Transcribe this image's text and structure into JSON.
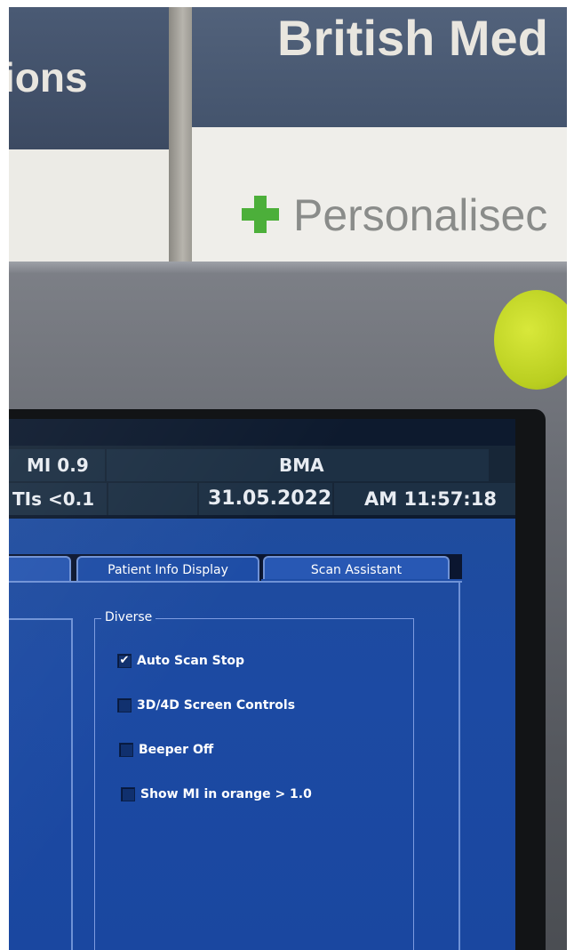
{
  "background_signs": {
    "left_text": "ions",
    "right_text": "British Med",
    "tagline": "Personalisec"
  },
  "statusbar": {
    "mi": "MI 0.9",
    "site": "BMA",
    "tis": "TIs <0.1",
    "date": "31.05.2022",
    "time": "AM 11:57:18"
  },
  "tabs": [
    {
      "label": ""
    },
    {
      "label": "Patient Info Display"
    },
    {
      "label": "Scan Assistant"
    }
  ],
  "group": {
    "title": "Diverse",
    "options": [
      {
        "label": "Auto Scan Stop",
        "checked": true
      },
      {
        "label": "3D/4D Screen Controls",
        "checked": false
      },
      {
        "label": "Beeper Off",
        "checked": false
      },
      {
        "label": "Show MI in orange > 1.0",
        "checked": false
      }
    ]
  },
  "colors": {
    "panel": "#1e4ca2",
    "tab_border": "#6f92d6",
    "status_cell": "#1d3044",
    "sticker": "#c4d82a"
  }
}
